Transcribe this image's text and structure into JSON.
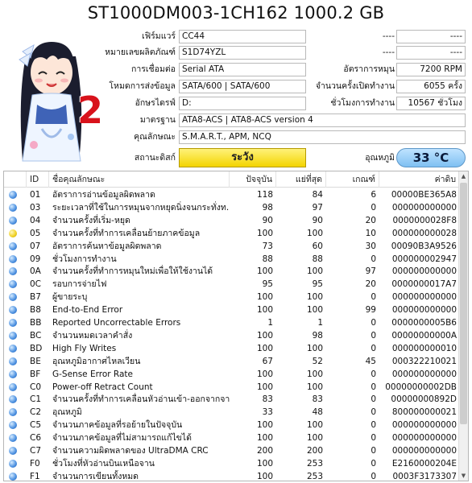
{
  "title": "ST1000DM003-1CH162 1000.2 GB",
  "badge_number": "2",
  "info_left": [
    {
      "label": "เฟิร์มแวร์",
      "value": "CC44"
    },
    {
      "label": "หมายเลขผลิตภัณฑ์",
      "value": "S1D74YZL"
    },
    {
      "label": "การเชื่อมต่อ",
      "value": "Serial ATA"
    },
    {
      "label": "โหมดการส่งข้อมูล",
      "value": "SATA/600 | SATA/600"
    },
    {
      "label": "อักษรไดรฟ์",
      "value": "D:"
    }
  ],
  "info_right": [
    {
      "label": "",
      "value": "----",
      "value2": "----"
    },
    {
      "label": "",
      "value": "----",
      "value2": "----"
    },
    {
      "label": "อัตราการหมุน",
      "value": "7200 RPM"
    },
    {
      "label": "จำนวนครั้งเปิดทำงาน",
      "value": "6055 ครั้ง"
    },
    {
      "label": "ชั่วโมงการทำงาน",
      "value": "10567 ชั่วโมง"
    }
  ],
  "standard": {
    "label": "มาตรฐาน",
    "value": "ATA8-ACS | ATA8-ACS version 4"
  },
  "features": {
    "label": "คุณลักษณะ",
    "value": "S.M.A.R.T., APM, NCQ"
  },
  "health": {
    "label": "สถานะดิสก์",
    "value": "ระวัง"
  },
  "temperature": {
    "label": "อุณหภูมิ",
    "value": "33 °C"
  },
  "table": {
    "headers": [
      "ID",
      "ชื่อคุณลักษณะ",
      "ปัจจุบัน",
      "แย่ที่สุด",
      "เกณฑ์",
      "ค่าดิบ"
    ],
    "rows": [
      {
        "id": "01",
        "name": "อัตราการอ่านข้อมูลผิดพลาด",
        "cur": "118",
        "worst": "84",
        "thr": "6",
        "raw": "00000BE365A8",
        "status": "ok"
      },
      {
        "id": "03",
        "name": "ระยะเวลาที่ใช้ในการหมุนจากหยุดนิ่งจนกระทั่งท...",
        "cur": "98",
        "worst": "97",
        "thr": "0",
        "raw": "000000000000",
        "status": "ok"
      },
      {
        "id": "04",
        "name": "จำนวนครั้งที่เริ่ม-หยุด",
        "cur": "90",
        "worst": "90",
        "thr": "20",
        "raw": "0000000028F8",
        "status": "ok"
      },
      {
        "id": "05",
        "name": "จำนวนครั้งที่ทำการเคลื่อนย้ายภาคข้อมูล",
        "cur": "100",
        "worst": "100",
        "thr": "10",
        "raw": "000000000028",
        "status": "warn"
      },
      {
        "id": "07",
        "name": "อัตราการค้นหาข้อมูลผิดพลาด",
        "cur": "73",
        "worst": "60",
        "thr": "30",
        "raw": "00090B3A9526",
        "status": "ok"
      },
      {
        "id": "09",
        "name": "ชั่วโมงการทำงาน",
        "cur": "88",
        "worst": "88",
        "thr": "0",
        "raw": "000000002947",
        "status": "ok"
      },
      {
        "id": "0A",
        "name": "จำนวนครั้งที่ทำการหมุนใหม่เพื่อให้ใช้งานได้",
        "cur": "100",
        "worst": "100",
        "thr": "97",
        "raw": "000000000000",
        "status": "ok"
      },
      {
        "id": "0C",
        "name": "รอบการจ่ายไฟ",
        "cur": "95",
        "worst": "95",
        "thr": "20",
        "raw": "0000000017A7",
        "status": "ok"
      },
      {
        "id": "B7",
        "name": "ผู้ขายระบุ",
        "cur": "100",
        "worst": "100",
        "thr": "0",
        "raw": "000000000000",
        "status": "ok"
      },
      {
        "id": "B8",
        "name": "End-to-End Error",
        "cur": "100",
        "worst": "100",
        "thr": "99",
        "raw": "000000000000",
        "status": "ok"
      },
      {
        "id": "BB",
        "name": "Reported Uncorrectable Errors",
        "cur": "1",
        "worst": "1",
        "thr": "0",
        "raw": "0000000005B6",
        "status": "ok"
      },
      {
        "id": "BC",
        "name": "จำนวนหมดเวลาคำสั่ง",
        "cur": "100",
        "worst": "98",
        "thr": "0",
        "raw": "00000000000A",
        "status": "ok"
      },
      {
        "id": "BD",
        "name": "High Fly Writes",
        "cur": "100",
        "worst": "100",
        "thr": "0",
        "raw": "000000000010",
        "status": "ok"
      },
      {
        "id": "BE",
        "name": "อุณหภูมิอากาศไหลเวียน",
        "cur": "67",
        "worst": "52",
        "thr": "45",
        "raw": "000322210021",
        "status": "ok"
      },
      {
        "id": "BF",
        "name": "G-Sense Error Rate",
        "cur": "100",
        "worst": "100",
        "thr": "0",
        "raw": "000000000000",
        "status": "ok"
      },
      {
        "id": "C0",
        "name": "Power-off Retract Count",
        "cur": "100",
        "worst": "100",
        "thr": "0",
        "raw": "00000000002DB",
        "status": "ok"
      },
      {
        "id": "C1",
        "name": "จำนวนครั้งที่ทำการเคลื่อนหัวอ่านเข้า-ออกจากจาน",
        "cur": "83",
        "worst": "83",
        "thr": "0",
        "raw": "00000000892D",
        "status": "ok"
      },
      {
        "id": "C2",
        "name": "อุณหภูมิ",
        "cur": "33",
        "worst": "48",
        "thr": "0",
        "raw": "800000000021",
        "status": "ok"
      },
      {
        "id": "C5",
        "name": "จำนวนภาคข้อมูลที่รอย้ายในปัจจุบัน",
        "cur": "100",
        "worst": "100",
        "thr": "0",
        "raw": "000000000000",
        "status": "ok"
      },
      {
        "id": "C6",
        "name": "จำนวนภาคข้อมูลที่ไม่สามารถแก้ไขได้",
        "cur": "100",
        "worst": "100",
        "thr": "0",
        "raw": "000000000000",
        "status": "ok"
      },
      {
        "id": "C7",
        "name": "จำนวนความผิดพลาดของ UltraDMA CRC",
        "cur": "200",
        "worst": "200",
        "thr": "0",
        "raw": "000000000000",
        "status": "ok"
      },
      {
        "id": "F0",
        "name": "ชั่วโมงที่หัวอ่านบินเหนือจาน",
        "cur": "100",
        "worst": "253",
        "thr": "0",
        "raw": "E2160000204E",
        "status": "ok"
      },
      {
        "id": "F1",
        "name": "จำนวนการเขียนทั้งหมด",
        "cur": "100",
        "worst": "253",
        "thr": "0",
        "raw": "0003F3173307",
        "status": "ok"
      }
    ]
  },
  "colors": {
    "health_bg": "#f3d400",
    "temp_bg": "#7fc0f2",
    "badge": "#d8121b",
    "status_ok": "#4a8fe0",
    "status_warn": "#f0d020"
  }
}
